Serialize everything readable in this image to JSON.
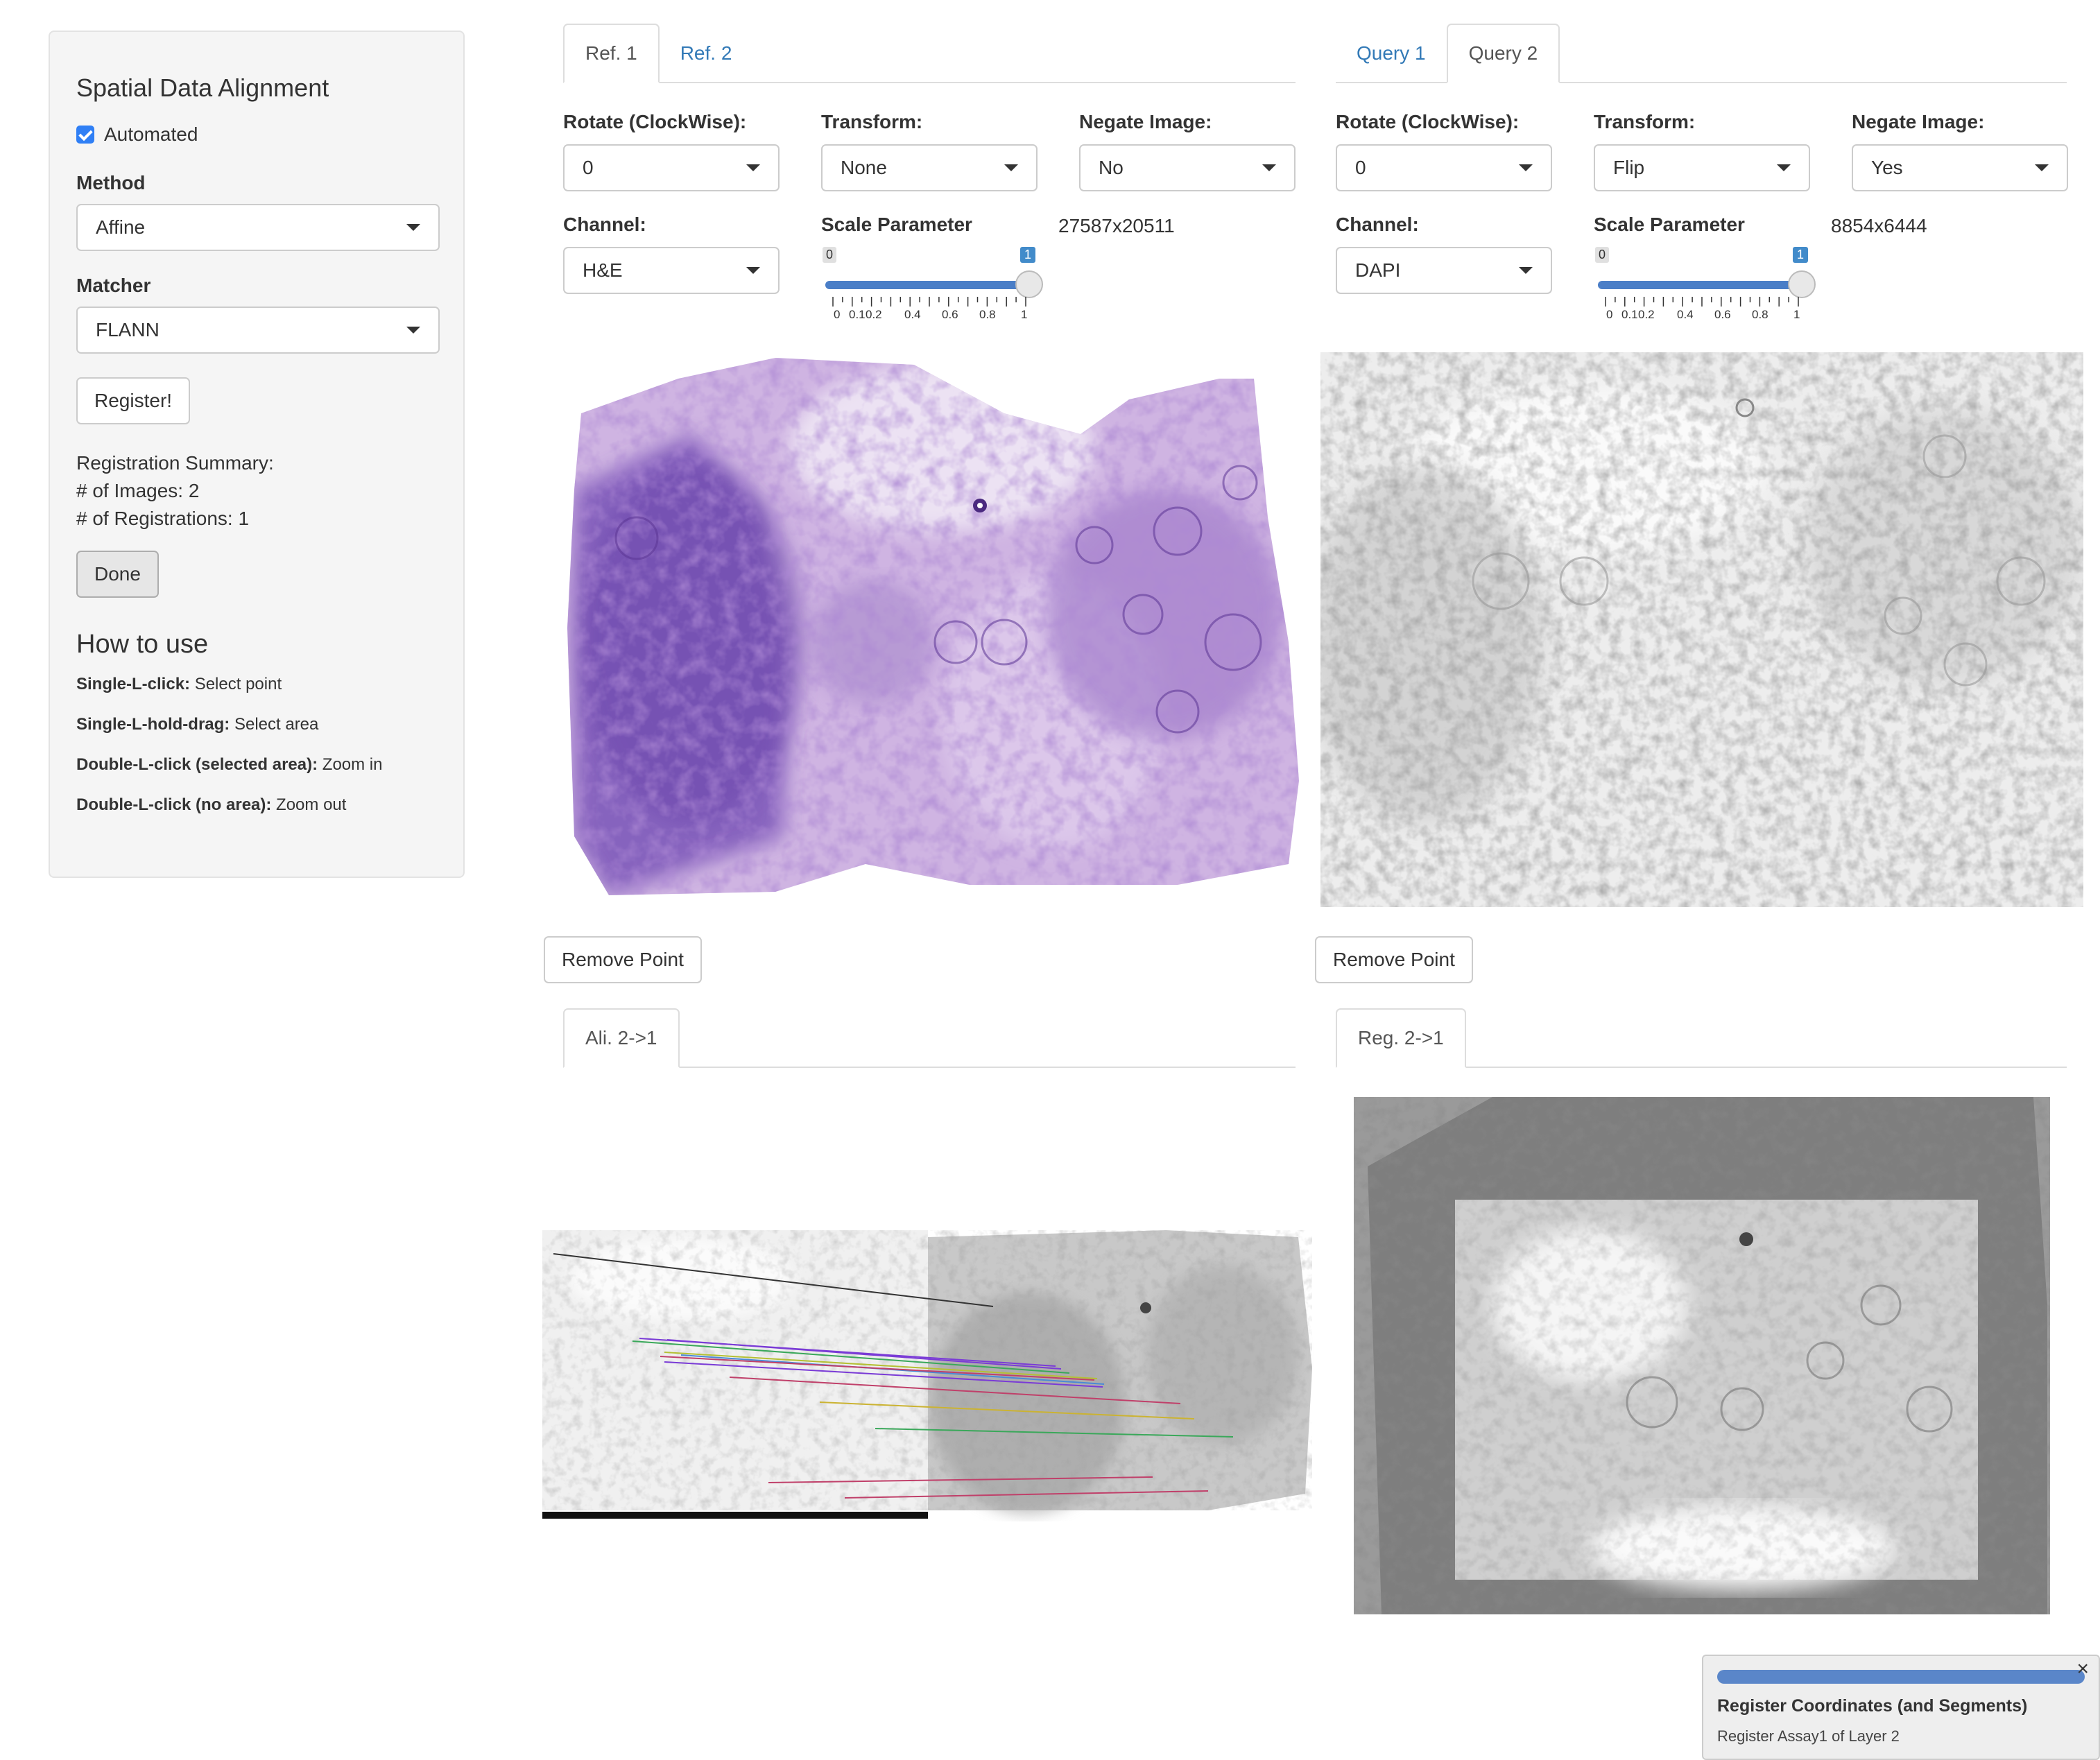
{
  "sidebar": {
    "title": "Spatial Data Alignment",
    "automated_label": "Automated",
    "automated_checked": true,
    "method_label": "Method",
    "method_value": "Affine",
    "matcher_label": "Matcher",
    "matcher_value": "FLANN",
    "register_button": "Register!",
    "summary": {
      "title": "Registration Summary:",
      "images": "# of Images: 2",
      "registrations": "# of Registrations: 1"
    },
    "done_button": "Done",
    "howto": {
      "title": "How to use",
      "items": [
        {
          "action": "Single-L-click:",
          "desc": "Select point"
        },
        {
          "action": "Single-L-hold-drag:",
          "desc": "Select area"
        },
        {
          "action": "Double-L-click (selected area):",
          "desc": "Zoom in"
        },
        {
          "action": "Double-L-click (no area):",
          "desc": "Zoom out"
        }
      ]
    }
  },
  "ref_panel": {
    "tabs": [
      {
        "label": "Ref. 1",
        "active": true
      },
      {
        "label": "Ref. 2",
        "active": false
      }
    ],
    "rotate_label": "Rotate (ClockWise):",
    "rotate_value": "0",
    "transform_label": "Transform:",
    "transform_value": "None",
    "negate_label": "Negate Image:",
    "negate_value": "No",
    "channel_label": "Channel:",
    "channel_value": "H&E",
    "scale_label": "Scale Parameter",
    "scale_min": "0",
    "scale_max": "1",
    "scale_value": 1,
    "scale_ticks": [
      "0",
      "0.1",
      "0.2",
      "0.4",
      "0.6",
      "0.8",
      "1"
    ],
    "dimensions": "27587x20511",
    "remove_point_button": "Remove Point"
  },
  "query_panel": {
    "tabs": [
      {
        "label": "Query 1",
        "active": false
      },
      {
        "label": "Query 2",
        "active": true
      }
    ],
    "rotate_label": "Rotate (ClockWise):",
    "rotate_value": "0",
    "transform_label": "Transform:",
    "transform_value": "Flip",
    "negate_label": "Negate Image:",
    "negate_value": "Yes",
    "channel_label": "Channel:",
    "channel_value": "DAPI",
    "scale_label": "Scale Parameter",
    "scale_min": "0",
    "scale_max": "1",
    "scale_value": 1,
    "scale_ticks": [
      "0",
      "0.1",
      "0.2",
      "0.4",
      "0.6",
      "0.8",
      "1"
    ],
    "dimensions": "8854x6444",
    "remove_point_button": "Remove Point"
  },
  "alignment_panel": {
    "tab": "Ali. 2->1"
  },
  "registration_panel": {
    "tab": "Reg. 2->1"
  },
  "notification": {
    "progress": 1.0,
    "message": "Register Coordinates (and Segments)",
    "detail": "Register Assay1 of Layer 2",
    "close_icon": "×"
  },
  "colors": {
    "link": "#337ab7",
    "slider": "#4a7ec7",
    "he_stain": "#b892d0",
    "he_dark": "#6a3fa8"
  }
}
